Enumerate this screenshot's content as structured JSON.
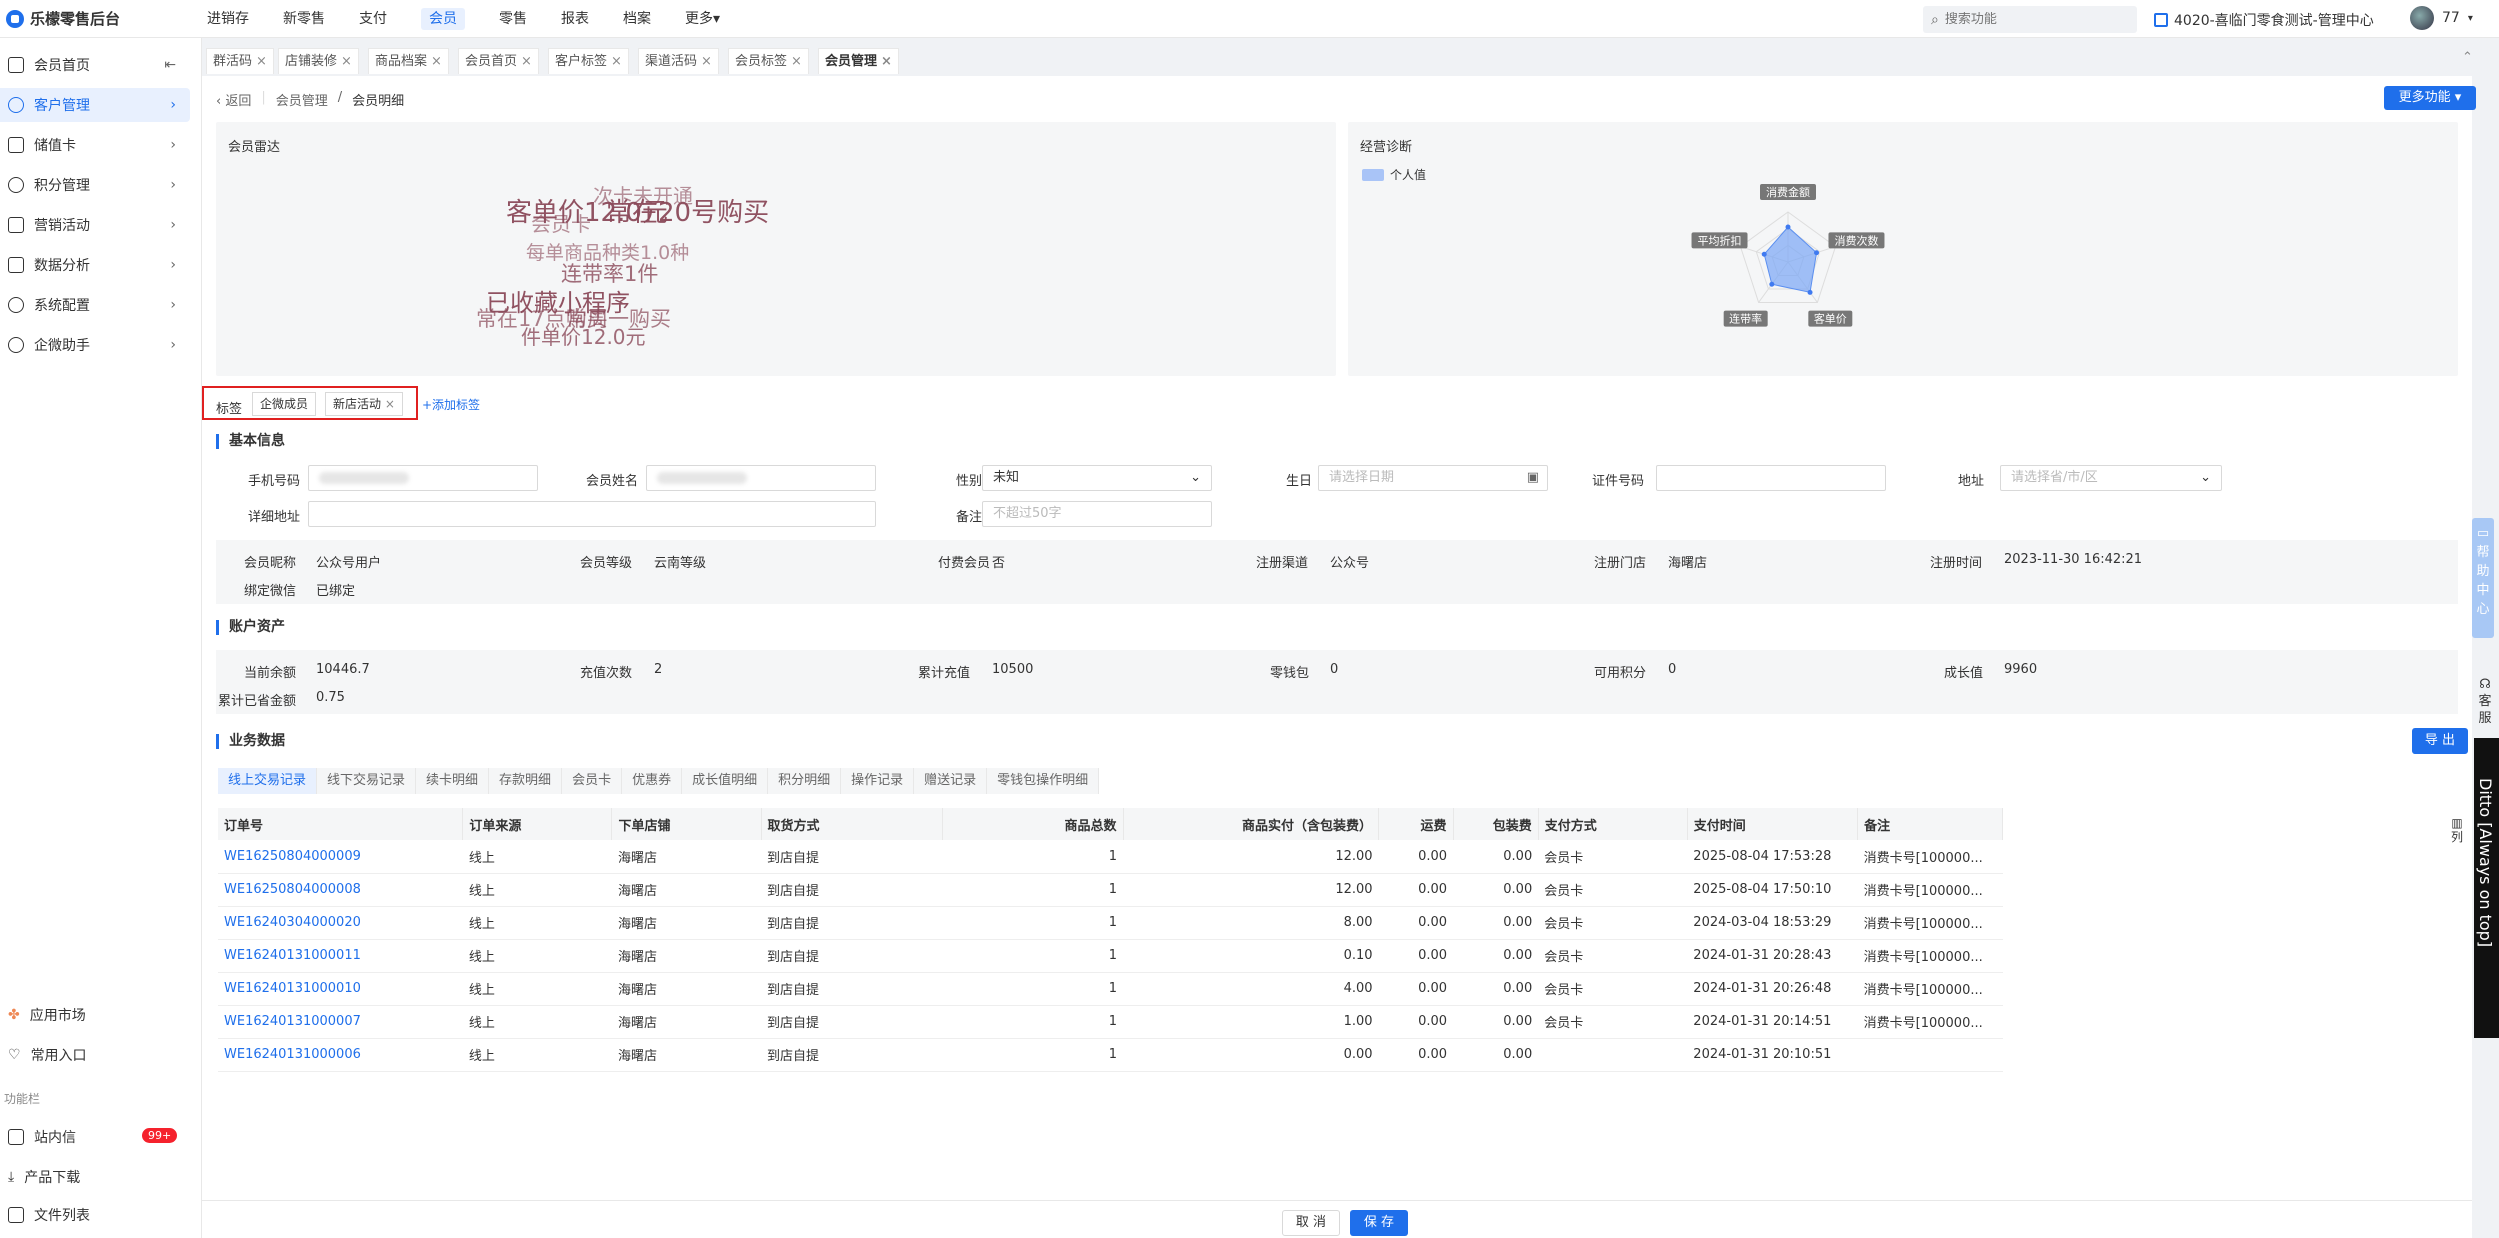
{
  "app": {
    "title": "乐檬零售后台"
  },
  "topnav": [
    {
      "label": "进销存",
      "active": false
    },
    {
      "label": "新零售",
      "active": false
    },
    {
      "label": "支付",
      "active": false
    },
    {
      "label": "会员",
      "active": true
    },
    {
      "label": "零售",
      "active": false
    },
    {
      "label": "报表",
      "active": false
    },
    {
      "label": "档案",
      "active": false
    },
    {
      "label": "更多▾",
      "active": false
    }
  ],
  "search": {
    "placeholder": "搜索功能"
  },
  "store": {
    "label": "4020-喜临门零食测试-管理中心"
  },
  "user": {
    "name": "77"
  },
  "sidebar": {
    "items": [
      {
        "label": "会员首页"
      },
      {
        "label": "客户管理"
      },
      {
        "label": "储值卡"
      },
      {
        "label": "积分管理"
      },
      {
        "label": "营销活动"
      },
      {
        "label": "数据分析"
      },
      {
        "label": "系统配置"
      },
      {
        "label": "企微助手"
      }
    ],
    "bottom": [
      {
        "label": "应用市场"
      },
      {
        "label": "常用入口"
      }
    ],
    "section_label": "功能栏",
    "func": [
      {
        "label": "站内信",
        "badge": "99+"
      },
      {
        "label": "产品下载"
      },
      {
        "label": "文件列表"
      }
    ]
  },
  "tabs": [
    "群活码",
    "店铺装修",
    "商品档案",
    "会员首页",
    "客户标签",
    "渠道活码",
    "会员标签",
    "会员管理"
  ],
  "breadcrumb": {
    "back": "返回",
    "parent": "会员管理",
    "sep": "/",
    "current": "会员明细"
  },
  "more_button": "更多功能",
  "radar_panel": {
    "title": "会员雷达",
    "words": [
      {
        "text": "客单价12.0元",
        "size": 26,
        "opacity": 0.95
      },
      {
        "text": "常在20号购买",
        "size": 26,
        "opacity": 0.95
      },
      {
        "text": "次卡未开通",
        "size": 20,
        "opacity": 0.6
      },
      {
        "text": "会员卡",
        "size": 20,
        "opacity": 0.6
      },
      {
        "text": "每单商品种类1.0种",
        "size": 19,
        "opacity": 0.6
      },
      {
        "text": "连带率1件",
        "size": 21,
        "opacity": 0.8
      },
      {
        "text": "已收藏小程序",
        "size": 24,
        "opacity": 0.95
      },
      {
        "text": "常在17点购买",
        "size": 21,
        "opacity": 0.7
      },
      {
        "text": "常周一购买",
        "size": 21,
        "opacity": 0.7
      },
      {
        "text": "件单价12.0元",
        "size": 20,
        "opacity": 0.8
      }
    ]
  },
  "diag_panel": {
    "title": "经营诊断",
    "legend": "个人值",
    "axes": [
      "消费金额",
      "消费次数",
      "客单价",
      "连带率",
      "平均折扣"
    ],
    "values": [
      0.7,
      0.6,
      0.75,
      0.55,
      0.5
    ],
    "accent": "#7aa7f5"
  },
  "tags": {
    "label": "标签",
    "items": [
      "企微成员",
      "新店活动"
    ],
    "add": "+添加标签"
  },
  "basic": {
    "title": "基本信息",
    "phone_label": "手机号码",
    "name_label": "会员姓名",
    "gender_label": "性别",
    "gender_value": "未知",
    "birthday_label": "生日",
    "birthday_placeholder": "请选择日期",
    "id_label": "证件号码",
    "address_label": "地址",
    "address_placeholder": "请选择省/市/区",
    "detail_label": "详细地址",
    "remark_label": "备注",
    "remark_placeholder": "不超过50字"
  },
  "info": [
    {
      "label": "会员昵称",
      "value": "公众号用户"
    },
    {
      "label": "会员等级",
      "value": "云南等级"
    },
    {
      "label": "付费会员",
      "value": "否"
    },
    {
      "label": "注册渠道",
      "value": "公众号"
    },
    {
      "label": "注册门店",
      "value": "海曙店"
    },
    {
      "label": "注册时间",
      "value": "2023-11-30 16:42:21"
    },
    {
      "label": "绑定微信",
      "value": "已绑定"
    }
  ],
  "assets": {
    "title": "账户资产",
    "items": [
      {
        "label": "当前余额",
        "value": "10446.7"
      },
      {
        "label": "充值次数",
        "value": "2"
      },
      {
        "label": "累计充值",
        "value": "10500"
      },
      {
        "label": "零钱包",
        "value": "0"
      },
      {
        "label": "可用积分",
        "value": "0"
      },
      {
        "label": "成长值",
        "value": "9960"
      },
      {
        "label": "累计已省金额",
        "value": "0.75"
      }
    ]
  },
  "business": {
    "title": "业务数据",
    "export": "导 出",
    "subtabs": [
      "线上交易记录",
      "线下交易记录",
      "续卡明细",
      "存款明细",
      "会员卡",
      "优惠券",
      "成长值明细",
      "积分明细",
      "操作记录",
      "赠送记录",
      "零钱包操作明细"
    ],
    "columns": [
      "订单号",
      "订单来源",
      "下单店铺",
      "取货方式",
      "商品总数",
      "商品实付（含包装费）",
      "运费",
      "包装费",
      "支付方式",
      "支付时间",
      "备注"
    ],
    "rows": [
      [
        "WE16250804000009",
        "线上",
        "海曙店",
        "到店自提",
        "1",
        "12.00",
        "0.00",
        "0.00",
        "会员卡",
        "2025-08-04 17:53:28",
        "消费卡号[100000..."
      ],
      [
        "WE16250804000008",
        "线上",
        "海曙店",
        "到店自提",
        "1",
        "12.00",
        "0.00",
        "0.00",
        "会员卡",
        "2025-08-04 17:50:10",
        "消费卡号[100000..."
      ],
      [
        "WE16240304000020",
        "线上",
        "海曙店",
        "到店自提",
        "1",
        "8.00",
        "0.00",
        "0.00",
        "会员卡",
        "2024-03-04 18:53:29",
        "消费卡号[100000..."
      ],
      [
        "WE16240131000011",
        "线上",
        "海曙店",
        "到店自提",
        "1",
        "0.10",
        "0.00",
        "0.00",
        "会员卡",
        "2024-01-31 20:28:43",
        "消费卡号[100000..."
      ],
      [
        "WE16240131000010",
        "线上",
        "海曙店",
        "到店自提",
        "1",
        "4.00",
        "0.00",
        "0.00",
        "会员卡",
        "2024-01-31 20:26:48",
        "消费卡号[100000..."
      ],
      [
        "WE16240131000007",
        "线上",
        "海曙店",
        "到店自提",
        "1",
        "1.00",
        "0.00",
        "0.00",
        "会员卡",
        "2024-01-31 20:14:51",
        "消费卡号[100000..."
      ],
      [
        "WE16240131000006",
        "线上",
        "海曙店",
        "到店自提",
        "1",
        "0.00",
        "0.00",
        "0.00",
        "",
        "2024-01-31 20:10:51",
        ""
      ]
    ],
    "col_setting": "列"
  },
  "footer": {
    "cancel": "取 消",
    "save": "保 存"
  },
  "floating": {
    "help": "帮助中心",
    "service": "客服",
    "ditto": "Ditto [Always on top]"
  }
}
